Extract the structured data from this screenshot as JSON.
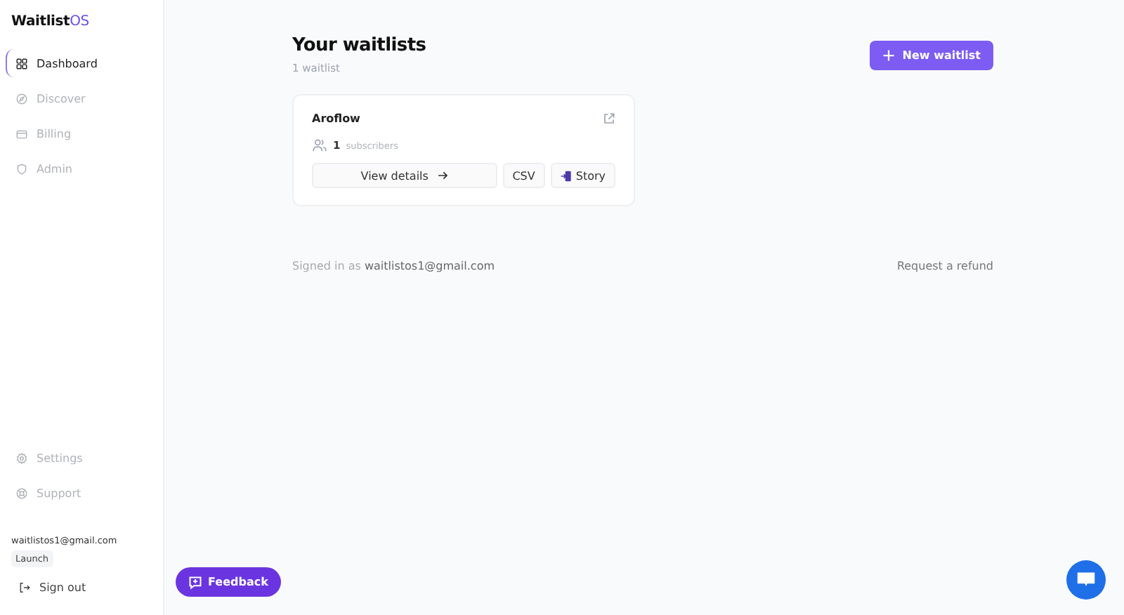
{
  "sidebar": {
    "logo": {
      "name": "Waitlist",
      "suffix": "OS"
    },
    "nav": [
      {
        "label": "Dashboard",
        "selected": true
      },
      {
        "label": "Discover",
        "selected": false
      },
      {
        "label": "Billing",
        "selected": false
      },
      {
        "label": "Admin",
        "selected": false
      }
    ],
    "bottom_nav": [
      {
        "label": "Settings"
      },
      {
        "label": "Support"
      }
    ],
    "account": {
      "email": "waitlistos1@gmail.com",
      "plan": "Launch"
    },
    "sign_out": "Sign out"
  },
  "header": {
    "title": "Your waitlists",
    "count": "1 waitlist",
    "new_button": "New waitlist"
  },
  "waitlists": [
    {
      "name": "Aroflow",
      "subscriber_count": "1",
      "subscriber_label": "subscribers",
      "view_button": "View details",
      "csv_button": "CSV",
      "story_button": "Story"
    }
  ],
  "footer": {
    "signed_in_prefix": "Signed in as",
    "email": "waitlistos1@gmail.com",
    "refund_link": "Request a refund"
  },
  "feedback_button": "Feedback"
}
